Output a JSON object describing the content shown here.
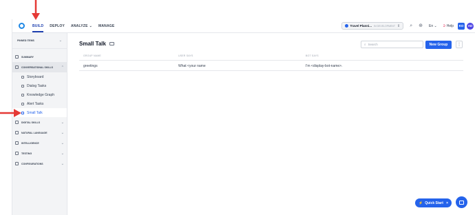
{
  "topbar": {
    "nav": [
      {
        "label": "BUILD",
        "active": true
      },
      {
        "label": "DEPLOY",
        "active": false
      },
      {
        "label": "ANALYZE",
        "active": false,
        "dropdown": true
      },
      {
        "label": "MANAGE",
        "active": false
      }
    ],
    "bot_name": "Travel Planni...",
    "bot_env": "IN DEVELOPMENT",
    "language": "En",
    "help_label": "Help",
    "user_initials_1": "KO",
    "user_initials_2": "AD"
  },
  "sidebar": {
    "pinned_label": "PINNED ITEMS",
    "items": [
      {
        "label": "SUMMARY"
      },
      {
        "label": "CONVERSATIONAL SKILLS"
      },
      {
        "label": "DIGITAL SKILLS"
      },
      {
        "label": "NATURAL LANGUAGE"
      },
      {
        "label": "INTELLIGENCE"
      },
      {
        "label": "TESTING"
      },
      {
        "label": "CONFIGURATIONS"
      }
    ],
    "sub_items": [
      {
        "label": "Storyboard"
      },
      {
        "label": "Dialog Tasks"
      },
      {
        "label": "Knowledge Graph"
      },
      {
        "label": "Alert Tasks"
      },
      {
        "label": "Small Talk",
        "active": true
      }
    ]
  },
  "main": {
    "title": "Small Talk",
    "search_placeholder": "Search",
    "new_group_label": "New Group",
    "columns": [
      "GROUP NAME",
      "USER SAYS",
      "BOT SAYS"
    ],
    "rows": [
      {
        "group": "greetings",
        "user": "What <your name",
        "bot": "I'm <display-bot-name>."
      }
    ]
  },
  "quick_start_label": "Quick Start",
  "colors": {
    "accent": "#2563eb",
    "annotation_arrow": "#e53935"
  }
}
